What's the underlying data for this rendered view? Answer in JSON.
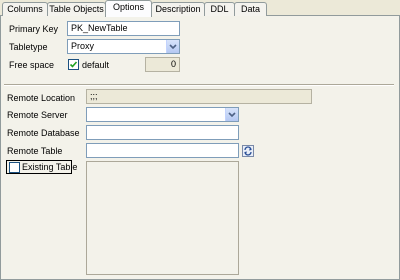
{
  "tabs": [
    {
      "label": "Columns",
      "active": false
    },
    {
      "label": "Table Objects",
      "active": false
    },
    {
      "label": "Options",
      "active": true
    },
    {
      "label": "Description",
      "active": false
    },
    {
      "label": "DDL",
      "active": false
    },
    {
      "label": "Data",
      "active": false
    }
  ],
  "form": {
    "primary_key_label": "Primary Key",
    "primary_key_value": "PK_NewTable",
    "tabletype_label": "Tabletype",
    "tabletype_value": "Proxy",
    "free_space_label": "Free space",
    "default_label": "default",
    "default_checked": true,
    "free_space_value": "0",
    "remote_location_label": "Remote Location",
    "remote_location_value": ";;;",
    "remote_server_label": "Remote Server",
    "remote_server_value": "",
    "remote_database_label": "Remote Database",
    "remote_database_value": "",
    "remote_table_label": "Remote Table",
    "remote_table_value": "",
    "existing_table_label": "Existing Table",
    "existing_table_checked": false
  },
  "icons": {
    "dropdown": "chevron-down-icon",
    "checkmark": "checkmark-icon",
    "refresh": "refresh-icon"
  },
  "colors": {
    "panel_bg": "#f3f2ea",
    "field_border": "#7f9db9",
    "accent": "#1c5180"
  }
}
